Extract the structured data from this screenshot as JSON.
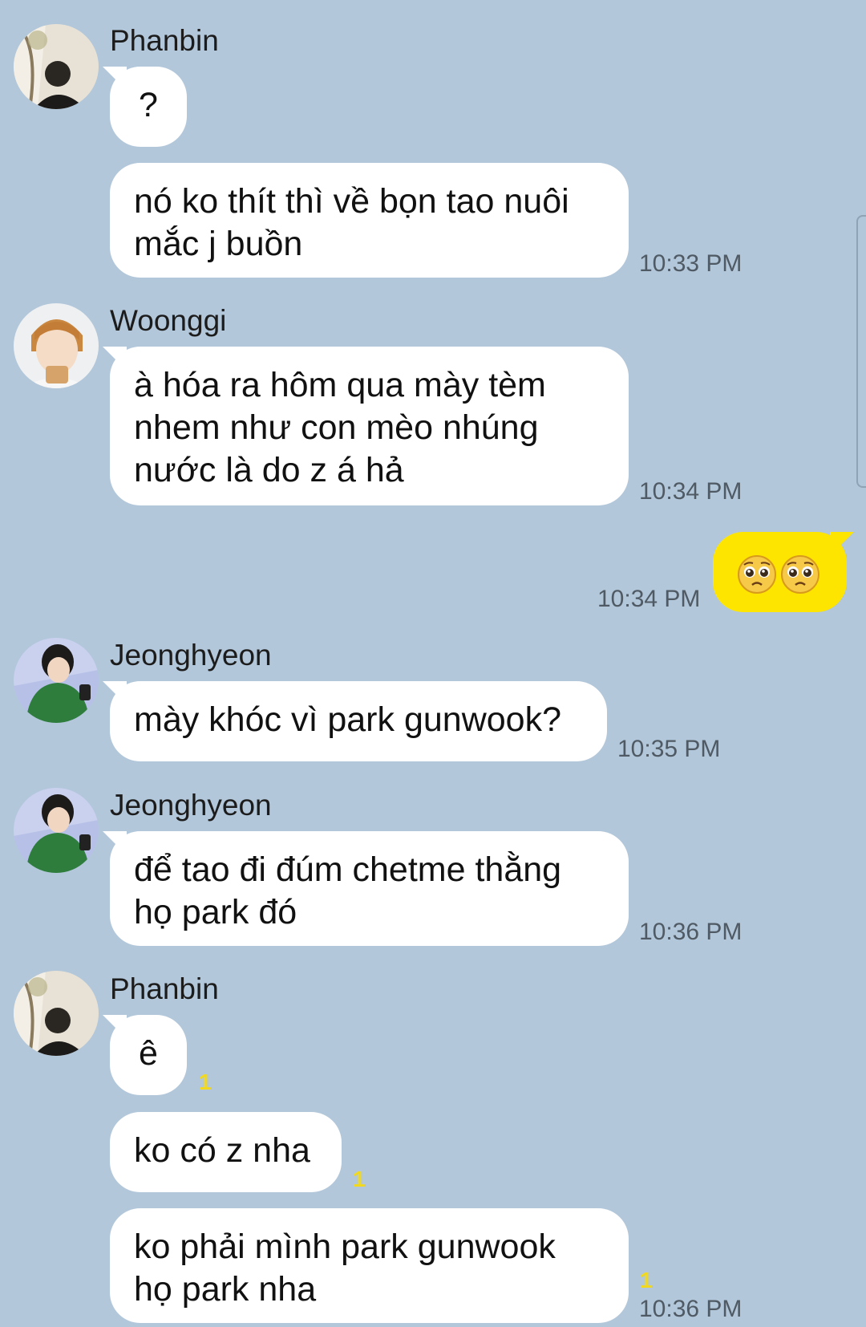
{
  "colors": {
    "background": "#b2c7da",
    "incoming_bubble": "#ffffff",
    "outgoing_bubble": "#fee500",
    "unread": "#f2d91c"
  },
  "messages": [
    {
      "sender": "Phanbin",
      "text": "?"
    },
    {
      "text_lines": [
        "nó ko thít thì về bọn tao nuôi",
        "mắc j buồn"
      ],
      "time": "10:33 PM"
    },
    {
      "sender": "Woonggi",
      "text_lines": [
        "à hóa ra hôm qua mày tèm",
        "nhem như con mèo nhúng",
        "nước là do z á hả"
      ],
      "time": "10:34 PM"
    },
    {
      "outgoing": true,
      "emoji": [
        "pleading-face-icon",
        "pleading-face-icon"
      ],
      "time": "10:34 PM"
    },
    {
      "sender": "Jeonghyeon",
      "text": "mày khóc vì park gunwook?",
      "time": "10:35 PM"
    },
    {
      "sender": "Jeonghyeon",
      "text_lines": [
        "để tao đi đúm chetme thằng",
        "họ park đó"
      ],
      "time": "10:36 PM"
    },
    {
      "sender": "Phanbin",
      "text": "ê",
      "unread": "1"
    },
    {
      "text": "ko có z nha",
      "unread": "1"
    },
    {
      "text_lines": [
        "ko phải mình park gunwook",
        "họ park nha"
      ],
      "unread": "1",
      "time": "10:36 PM"
    }
  ]
}
